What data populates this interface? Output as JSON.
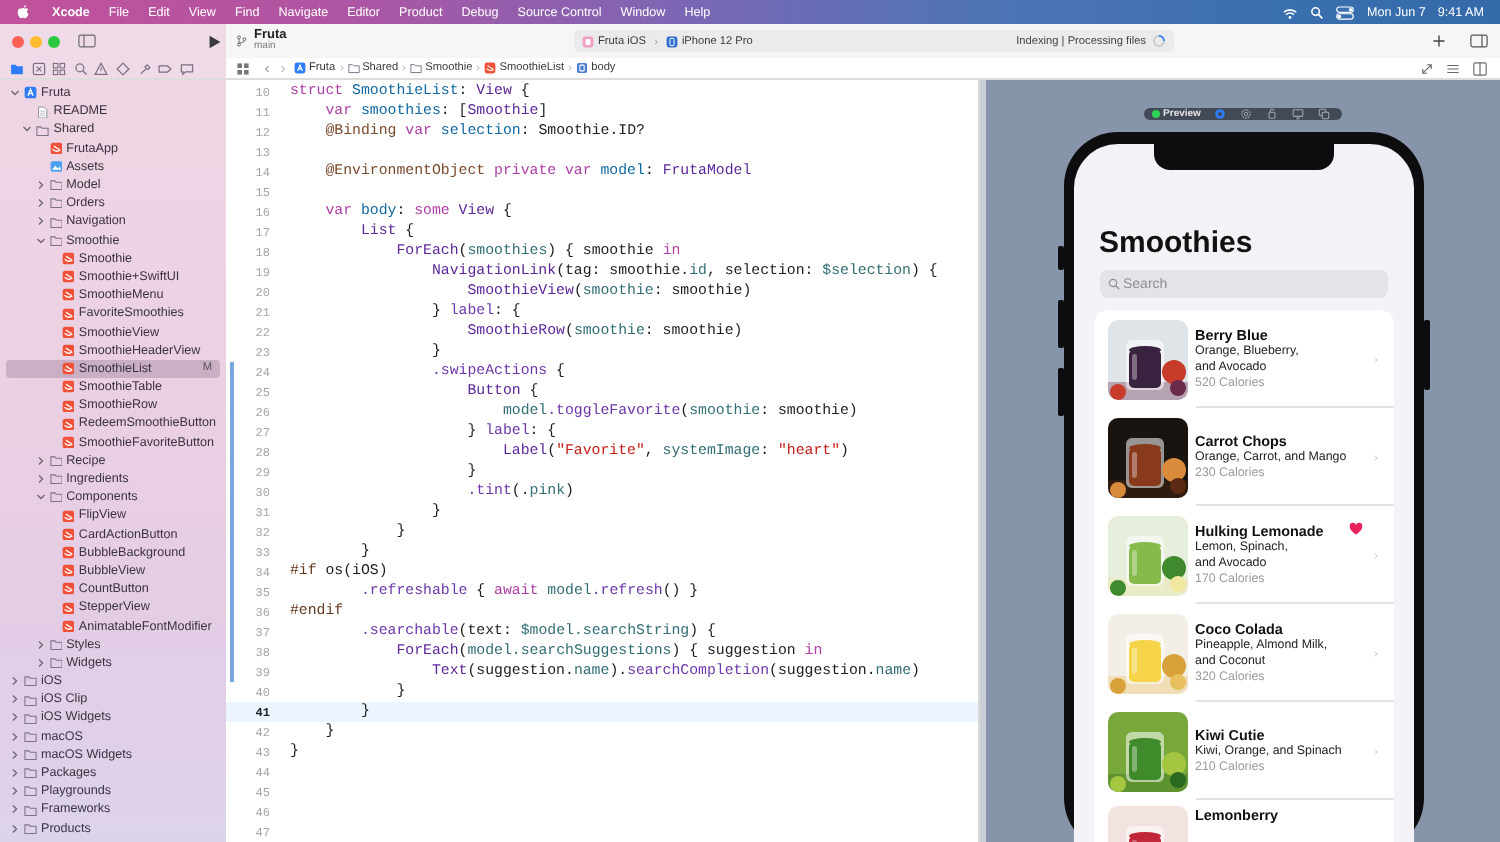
{
  "menu_bar": {
    "app": "Xcode",
    "menus": [
      "File",
      "Edit",
      "View",
      "Find",
      "Navigate",
      "Editor",
      "Product",
      "Debug",
      "Source Control",
      "Window",
      "Help"
    ],
    "date": "Mon Jun 7",
    "time": "9:41 AM"
  },
  "toolbar": {
    "project": "Fruta",
    "branch": "main",
    "scheme": "Fruta iOS",
    "destination": "iPhone 12 Pro",
    "activity": "Indexing | Processing files"
  },
  "navigator_tabs": [
    {
      "kind": "folder",
      "selected": true
    },
    {
      "kind": "source-control",
      "selected": false
    },
    {
      "kind": "symbols",
      "selected": false
    },
    {
      "kind": "find",
      "selected": false
    },
    {
      "kind": "issues",
      "selected": false
    },
    {
      "kind": "tests",
      "selected": false
    },
    {
      "kind": "debug",
      "selected": false
    },
    {
      "kind": "breakpoints",
      "selected": false
    },
    {
      "kind": "reports",
      "selected": false
    }
  ],
  "jump_bar": {
    "path": [
      {
        "label": "Fruta",
        "kind": "project"
      },
      {
        "label": "Shared",
        "kind": "folder"
      },
      {
        "label": "Smoothie",
        "kind": "folder"
      },
      {
        "label": "SmoothieList",
        "kind": "swift"
      },
      {
        "label": "body",
        "kind": "symbol"
      }
    ]
  },
  "navigator": {
    "items": [
      {
        "name": "Fruta",
        "kind": "project",
        "expanded": true,
        "selected": false,
        "children": [
          {
            "name": "README",
            "kind": "doc",
            "selected": false
          },
          {
            "name": "Shared",
            "kind": "folder",
            "expanded": true,
            "selected": false,
            "children": [
              {
                "name": "FrutaApp",
                "kind": "swift",
                "selected": false
              },
              {
                "name": "Assets",
                "kind": "assets",
                "selected": false
              },
              {
                "name": "Model",
                "kind": "folder",
                "expanded": false,
                "selected": false
              },
              {
                "name": "Orders",
                "kind": "folder",
                "expanded": false,
                "selected": false
              },
              {
                "name": "Navigation",
                "kind": "folder",
                "expanded": false,
                "selected": false
              },
              {
                "name": "Smoothie",
                "kind": "folder",
                "expanded": true,
                "selected": false,
                "children": [
                  {
                    "name": "Smoothie",
                    "kind": "swift",
                    "selected": false
                  },
                  {
                    "name": "Smoothie+SwiftUI",
                    "kind": "swift",
                    "selected": false
                  },
                  {
                    "name": "SmoothieMenu",
                    "kind": "swift",
                    "selected": false
                  },
                  {
                    "name": "FavoriteSmoothies",
                    "kind": "swift",
                    "selected": false
                  },
                  {
                    "name": "SmoothieView",
                    "kind": "swift",
                    "selected": false
                  },
                  {
                    "name": "SmoothieHeaderView",
                    "kind": "swift",
                    "selected": false
                  },
                  {
                    "name": "SmoothieList",
                    "kind": "swift",
                    "selected": true,
                    "status": "M"
                  },
                  {
                    "name": "SmoothieTable",
                    "kind": "swift",
                    "selected": false
                  },
                  {
                    "name": "SmoothieRow",
                    "kind": "swift",
                    "selected": false
                  },
                  {
                    "name": "RedeemSmoothieButton",
                    "kind": "swift",
                    "selected": false
                  },
                  {
                    "name": "SmoothieFavoriteButton",
                    "kind": "swift",
                    "selected": false
                  }
                ]
              },
              {
                "name": "Recipe",
                "kind": "folder",
                "expanded": false,
                "selected": false
              },
              {
                "name": "Ingredients",
                "kind": "folder",
                "expanded": false,
                "selected": false
              },
              {
                "name": "Components",
                "kind": "folder",
                "expanded": true,
                "selected": false,
                "children": [
                  {
                    "name": "FlipView",
                    "kind": "swift",
                    "selected": false
                  },
                  {
                    "name": "CardActionButton",
                    "kind": "swift",
                    "selected": false
                  },
                  {
                    "name": "BubbleBackground",
                    "kind": "swift",
                    "selected": false
                  },
                  {
                    "name": "BubbleView",
                    "kind": "swift",
                    "selected": false
                  },
                  {
                    "name": "CountButton",
                    "kind": "swift",
                    "selected": false
                  },
                  {
                    "name": "StepperView",
                    "kind": "swift",
                    "selected": false
                  },
                  {
                    "name": "AnimatableFontModifier",
                    "kind": "swift",
                    "selected": false
                  }
                ]
              },
              {
                "name": "Styles",
                "kind": "folder",
                "expanded": false,
                "selected": false
              },
              {
                "name": "Widgets",
                "kind": "folder",
                "expanded": false,
                "selected": false
              }
            ]
          }
        ]
      },
      {
        "name": "iOS",
        "kind": "folder",
        "expanded": false,
        "selected": false
      },
      {
        "name": "iOS Clip",
        "kind": "folder",
        "expanded": false,
        "selected": false
      },
      {
        "name": "iOS Widgets",
        "kind": "folder",
        "expanded": false,
        "selected": false
      },
      {
        "name": "macOS",
        "kind": "folder",
        "expanded": false,
        "selected": false
      },
      {
        "name": "macOS Widgets",
        "kind": "folder",
        "expanded": false,
        "selected": false
      },
      {
        "name": "Packages",
        "kind": "folder",
        "expanded": false,
        "selected": false
      },
      {
        "name": "Playgrounds",
        "kind": "folder",
        "expanded": false,
        "selected": false
      },
      {
        "name": "Frameworks",
        "kind": "folder",
        "expanded": false,
        "selected": false
      },
      {
        "name": "Products",
        "kind": "folder",
        "expanded": false,
        "selected": false
      }
    ]
  },
  "editor": {
    "lines": [
      {
        "number": "10",
        "changed": false,
        "current": false,
        "tokens": [
          {
            "kind": "keyword",
            "text": "struct "
          },
          {
            "kind": "declaration",
            "text": "SmoothieList"
          },
          {
            "kind": "plain",
            "text": ": "
          },
          {
            "kind": "type",
            "text": "View"
          },
          {
            "kind": "plain",
            "text": " {"
          }
        ]
      },
      {
        "number": "11",
        "changed": false,
        "current": false,
        "tokens": [
          {
            "kind": "keyword",
            "text": "    var "
          },
          {
            "kind": "declaration",
            "text": "smoothies"
          },
          {
            "kind": "plain",
            "text": ": ["
          },
          {
            "kind": "type",
            "text": "Smoothie"
          },
          {
            "kind": "plain",
            "text": "]"
          }
        ]
      },
      {
        "number": "12",
        "changed": false,
        "current": false,
        "tokens": [
          {
            "kind": "attribute",
            "text": "    @Binding "
          },
          {
            "kind": "keyword",
            "text": "var "
          },
          {
            "kind": "declaration",
            "text": "selection"
          },
          {
            "kind": "plain",
            "text": ": Smoothie.ID?"
          }
        ]
      },
      {
        "number": "13",
        "changed": false,
        "current": false
      },
      {
        "number": "14",
        "changed": false,
        "current": false,
        "tokens": [
          {
            "kind": "attribute",
            "text": "    @EnvironmentObject "
          },
          {
            "kind": "keyword",
            "text": "private var "
          },
          {
            "kind": "declaration",
            "text": "model"
          },
          {
            "kind": "plain",
            "text": ": "
          },
          {
            "kind": "type",
            "text": "FrutaModel"
          }
        ]
      },
      {
        "number": "15",
        "changed": false,
        "current": false
      },
      {
        "number": "16",
        "changed": false,
        "current": false,
        "tokens": [
          {
            "kind": "keyword",
            "text": "    var "
          },
          {
            "kind": "declaration",
            "text": "body"
          },
          {
            "kind": "plain",
            "text": ": "
          },
          {
            "kind": "keyword",
            "text": "some "
          },
          {
            "kind": "type",
            "text": "View"
          },
          {
            "kind": "plain",
            "text": " {"
          }
        ]
      },
      {
        "number": "17",
        "changed": false,
        "current": false,
        "tokens": [
          {
            "kind": "type",
            "text": "        List"
          },
          {
            "kind": "plain",
            "text": " {"
          }
        ]
      },
      {
        "number": "18",
        "changed": false,
        "current": false,
        "tokens": [
          {
            "kind": "type",
            "text": "            ForEach"
          },
          {
            "kind": "plain",
            "text": "("
          },
          {
            "kind": "property",
            "text": "smoothies"
          },
          {
            "kind": "plain",
            "text": ") { smoothie "
          },
          {
            "kind": "keyword",
            "text": "in"
          }
        ]
      },
      {
        "number": "19",
        "changed": false,
        "current": false,
        "tokens": [
          {
            "kind": "type",
            "text": "                NavigationLink"
          },
          {
            "kind": "plain",
            "text": "(tag: smoothie."
          },
          {
            "kind": "property",
            "text": "id"
          },
          {
            "kind": "plain",
            "text": ", selection: "
          },
          {
            "kind": "property",
            "text": "$selection"
          },
          {
            "kind": "plain",
            "text": ") {"
          }
        ]
      },
      {
        "number": "20",
        "changed": false,
        "current": false,
        "tokens": [
          {
            "kind": "type",
            "text": "                    SmoothieView"
          },
          {
            "kind": "plain",
            "text": "("
          },
          {
            "kind": "property",
            "text": "smoothie"
          },
          {
            "kind": "plain",
            "text": ": smoothie)"
          }
        ]
      },
      {
        "number": "21",
        "changed": false,
        "current": false,
        "tokens": [
          {
            "kind": "plain",
            "text": "                } "
          },
          {
            "kind": "method",
            "text": "label"
          },
          {
            "kind": "plain",
            "text": ": {"
          }
        ]
      },
      {
        "number": "22",
        "changed": false,
        "current": false,
        "tokens": [
          {
            "kind": "type",
            "text": "                    SmoothieRow"
          },
          {
            "kind": "plain",
            "text": "("
          },
          {
            "kind": "property",
            "text": "smoothie"
          },
          {
            "kind": "plain",
            "text": ": smoothie)"
          }
        ]
      },
      {
        "number": "23",
        "changed": false,
        "current": false,
        "tokens": [
          {
            "kind": "plain",
            "text": "                }"
          }
        ]
      },
      {
        "number": "24",
        "changed": true,
        "current": false,
        "tokens": [
          {
            "kind": "method",
            "text": "                .swipeActions"
          },
          {
            "kind": "plain",
            "text": " {"
          }
        ]
      },
      {
        "number": "25",
        "changed": true,
        "current": false,
        "tokens": [
          {
            "kind": "type",
            "text": "                    Button"
          },
          {
            "kind": "plain",
            "text": " {"
          }
        ]
      },
      {
        "number": "26",
        "changed": true,
        "current": false,
        "tokens": [
          {
            "kind": "property",
            "text": "                        model"
          },
          {
            "kind": "method",
            "text": ".toggleFavorite"
          },
          {
            "kind": "plain",
            "text": "("
          },
          {
            "kind": "property",
            "text": "smoothie"
          },
          {
            "kind": "plain",
            "text": ": smoothie)"
          }
        ]
      },
      {
        "number": "27",
        "changed": true,
        "current": false,
        "tokens": [
          {
            "kind": "plain",
            "text": "                    } "
          },
          {
            "kind": "method",
            "text": "label"
          },
          {
            "kind": "plain",
            "text": ": {"
          }
        ]
      },
      {
        "number": "28",
        "changed": true,
        "current": false,
        "tokens": [
          {
            "kind": "type",
            "text": "                        Label"
          },
          {
            "kind": "plain",
            "text": "("
          },
          {
            "kind": "string",
            "text": "\"Favorite\""
          },
          {
            "kind": "plain",
            "text": ", "
          },
          {
            "kind": "property",
            "text": "systemImage"
          },
          {
            "kind": "plain",
            "text": ": "
          },
          {
            "kind": "string",
            "text": "\"heart\""
          },
          {
            "kind": "plain",
            "text": ")"
          }
        ]
      },
      {
        "number": "29",
        "changed": true,
        "current": false,
        "tokens": [
          {
            "kind": "plain",
            "text": "                    }"
          }
        ]
      },
      {
        "number": "30",
        "changed": true,
        "current": false,
        "tokens": [
          {
            "kind": "method",
            "text": "                    .tint"
          },
          {
            "kind": "plain",
            "text": "(."
          },
          {
            "kind": "property",
            "text": "pink"
          },
          {
            "kind": "plain",
            "text": ")"
          }
        ]
      },
      {
        "number": "31",
        "changed": true,
        "current": false,
        "tokens": [
          {
            "kind": "plain",
            "text": "                }"
          }
        ]
      },
      {
        "number": "32",
        "changed": true,
        "current": false,
        "tokens": [
          {
            "kind": "plain",
            "text": "            }"
          }
        ]
      },
      {
        "number": "33",
        "changed": true,
        "current": false,
        "tokens": [
          {
            "kind": "plain",
            "text": "        }"
          }
        ]
      },
      {
        "number": "34",
        "changed": true,
        "current": false,
        "tokens": [
          {
            "kind": "directive",
            "text": "#if"
          },
          {
            "kind": "plain",
            "text": " os(iOS)"
          }
        ]
      },
      {
        "number": "35",
        "changed": true,
        "current": false,
        "tokens": [
          {
            "kind": "method",
            "text": "        .refreshable"
          },
          {
            "kind": "plain",
            "text": " { "
          },
          {
            "kind": "keyword",
            "text": "await "
          },
          {
            "kind": "property",
            "text": "model"
          },
          {
            "kind": "method",
            "text": ".refresh"
          },
          {
            "kind": "plain",
            "text": "() }"
          }
        ]
      },
      {
        "number": "36",
        "changed": true,
        "current": false,
        "tokens": [
          {
            "kind": "directive",
            "text": "#endif"
          }
        ]
      },
      {
        "number": "37",
        "changed": true,
        "current": false,
        "tokens": [
          {
            "kind": "method",
            "text": "        .searchable"
          },
          {
            "kind": "plain",
            "text": "(text: "
          },
          {
            "kind": "property",
            "text": "$model"
          },
          {
            "kind": "property",
            "text": ".searchString"
          },
          {
            "kind": "plain",
            "text": ") {"
          }
        ]
      },
      {
        "number": "38",
        "changed": true,
        "current": false,
        "tokens": [
          {
            "kind": "type",
            "text": "            ForEach"
          },
          {
            "kind": "plain",
            "text": "("
          },
          {
            "kind": "property",
            "text": "model"
          },
          {
            "kind": "property",
            "text": ".searchSuggestions"
          },
          {
            "kind": "plain",
            "text": ") { suggestion "
          },
          {
            "kind": "keyword",
            "text": "in"
          }
        ]
      },
      {
        "number": "39",
        "changed": true,
        "current": false,
        "tokens": [
          {
            "kind": "type",
            "text": "                Text"
          },
          {
            "kind": "plain",
            "text": "(suggestion."
          },
          {
            "kind": "property",
            "text": "name"
          },
          {
            "kind": "plain",
            "text": ")."
          },
          {
            "kind": "method",
            "text": "searchCompletion"
          },
          {
            "kind": "plain",
            "text": "(suggestion."
          },
          {
            "kind": "property",
            "text": "name"
          },
          {
            "kind": "plain",
            "text": ")"
          }
        ]
      },
      {
        "number": "40",
        "changed": false,
        "current": false,
        "tokens": [
          {
            "kind": "plain",
            "text": "            }"
          }
        ]
      },
      {
        "number": "41",
        "changed": false,
        "current": true,
        "tokens": [
          {
            "kind": "plain",
            "text": "        }"
          }
        ]
      },
      {
        "number": "42",
        "changed": false,
        "current": false,
        "tokens": [
          {
            "kind": "plain",
            "text": "    }"
          }
        ]
      },
      {
        "number": "43",
        "changed": false,
        "current": false,
        "tokens": [
          {
            "kind": "plain",
            "text": "}"
          }
        ]
      },
      {
        "number": "44",
        "changed": false,
        "current": false
      },
      {
        "number": "45",
        "changed": false,
        "current": false
      },
      {
        "number": "46",
        "changed": false,
        "current": false
      },
      {
        "number": "47",
        "changed": false,
        "current": false
      }
    ]
  },
  "preview": {
    "mode_label": "Preview",
    "controls": [
      {
        "kind": "live",
        "selected": true
      },
      {
        "kind": "inspect",
        "selected": false
      },
      {
        "kind": "rotate",
        "selected": false
      },
      {
        "kind": "device",
        "selected": false
      },
      {
        "kind": "duplicate",
        "selected": false
      }
    ],
    "screen": {
      "title": "Smoothies",
      "search": {
        "placeholder": "Search"
      },
      "rows": [
        {
          "name": "Berry Blue",
          "ingredients": [
            "Orange, Blueberry,",
            "and Avocado"
          ],
          "calories": "520 Calories",
          "favorite": false
        },
        {
          "name": "Carrot Chops",
          "ingredients": [
            "Orange, Carrot, and Mango"
          ],
          "calories": "230 Calories",
          "favorite": false
        },
        {
          "name": "Hulking Lemonade",
          "ingredients": [
            "Lemon, Spinach,",
            "and Avocado"
          ],
          "calories": "170 Calories",
          "favorite": true
        },
        {
          "name": "Coco Colada",
          "ingredients": [
            "Pineapple, Almond Milk,",
            "and Coconut"
          ],
          "calories": "320 Calories",
          "favorite": false
        },
        {
          "name": "Kiwi Cutie",
          "ingredients": [
            "Kiwi, Orange, and Spinach"
          ],
          "calories": "210 Calories",
          "favorite": false
        },
        {
          "name": "Lemonberry",
          "favorite": false
        }
      ]
    }
  }
}
